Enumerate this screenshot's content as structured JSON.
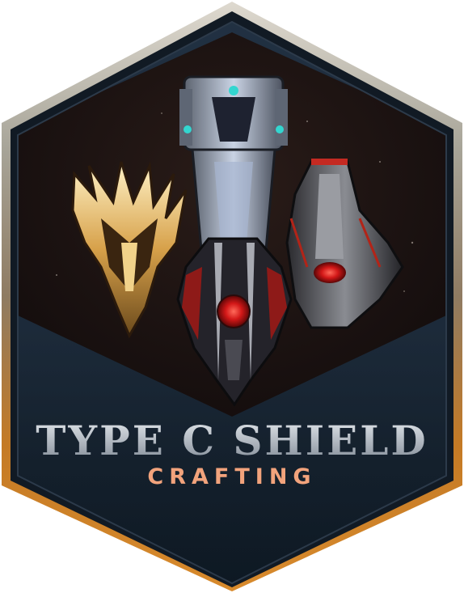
{
  "badge": {
    "title": "TYPE C SHIELD",
    "subtitle": "CRAFTING",
    "icon": "spaceship-shields-artwork",
    "colors": {
      "frame_top": "#d8d6d0",
      "frame_bottom": "#c47a25",
      "panel_dark": "#0f1c28",
      "panel_mid": "#1b2c3b",
      "artwork_bg": "#1a1110",
      "title_silver": "#b7bec6",
      "subtitle_orange": "#f2a37c"
    }
  }
}
